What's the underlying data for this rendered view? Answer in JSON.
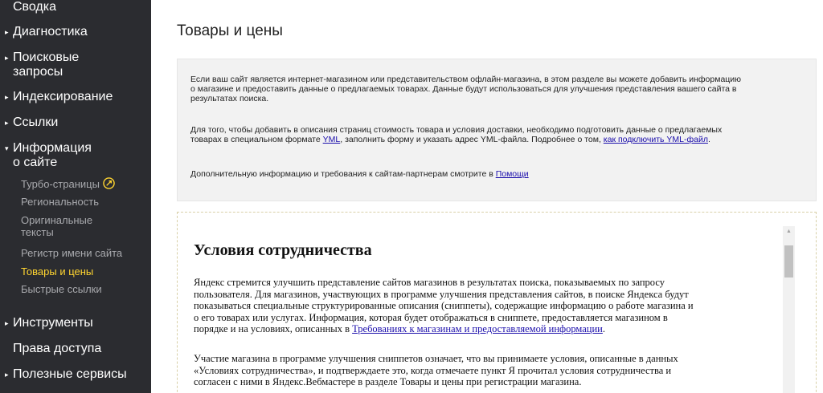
{
  "sidebar": {
    "items": [
      {
        "label": "Сводка",
        "arrow": ""
      },
      {
        "label": "Диагностика",
        "arrow": "▸"
      },
      {
        "label": "Поисковые",
        "label2": "запросы",
        "arrow": "▸"
      },
      {
        "label": "Индексирование",
        "arrow": "▸"
      },
      {
        "label": "Ссылки",
        "arrow": "▸"
      },
      {
        "label": "Информация",
        "label2": "о сайте",
        "arrow": "▾"
      },
      {
        "label": "Инструменты",
        "arrow": "▸"
      },
      {
        "label": "Права доступа",
        "arrow": ""
      },
      {
        "label": "Полезные сервисы",
        "arrow": "▸"
      }
    ],
    "subitems": [
      {
        "label": "Турбо-страницы",
        "icon": "turbo-icon"
      },
      {
        "label": "Региональность"
      },
      {
        "label": "Оригинальные",
        "label2": "тексты"
      },
      {
        "label": "Регистр имени сайта"
      },
      {
        "label": "Товары и цены",
        "active": true
      },
      {
        "label": "Быстрые ссылки"
      }
    ]
  },
  "main": {
    "title": "Товары и цены",
    "info": {
      "p1_line1": "Если ваш сайт является интернет-магазином или представительством офлайн-магазина, в этом разделе вы можете добавить информацию",
      "p1_line2": "о магазине и предоставить данные о предлагаемых товарах. Данные будут использоваться для улучшения представления вашего сайта в",
      "p1_line3": "результатах поиска.",
      "p2_line1": "Для того, чтобы добавить в описания страниц стоимость товара и условия доставки, необходимо подготовить данные о предлагаемых",
      "p2_line2_a": "товарах в специальном формате ",
      "p2_link1": "YML",
      "p2_line2_b": ", заполнить форму и указать адрес YML-файла. Подробнее о том, ",
      "p2_link2": "как подключить YML-файл",
      "p2_line2_c": ".",
      "p3_text": "Дополнительную информацию и требования к сайтам-партнерам смотрите в ",
      "p3_link": "Помощи"
    },
    "terms": {
      "title": "Условия сотрудничества",
      "p1_l1": "Яндекс стремится улучшить представление сайтов магазинов в результатах поиска, показываемых по запросу",
      "p1_l2": "пользователя. Для магазинов, участвующих в программе улучшения представления сайтов, в поиске Яндекса будут",
      "p1_l3": "показываться специальные структурированные описания (сниппеты), содержащие информацию о работе магазина и",
      "p1_l4": "о его товарах или услугах. Информация, которая будет отображаться в сниппете, предоставляется магазином в",
      "p1_l5_a": "порядке и на условиях, описанных в ",
      "p1_link": "Требованиях к магазинам и предоставляемой информации",
      "p1_l5_b": ".",
      "p2_l1": "Участие магазина в программе улучшения сниппетов означает, что вы принимаете условия, описанные в данных",
      "p2_l2": "«Условиях сотрудничества», и подтверждаете это, когда отмечаете пункт Я прочитал условия сотрудничества и",
      "p2_l3": "согласен с ними в Яндекс.Вебмастере в разделе Товары и цены при регистрации магазина."
    }
  },
  "colors": {
    "sidebar_bg": "#2b2c30",
    "active_item": "#ffd530",
    "link": "#1a0dab"
  }
}
